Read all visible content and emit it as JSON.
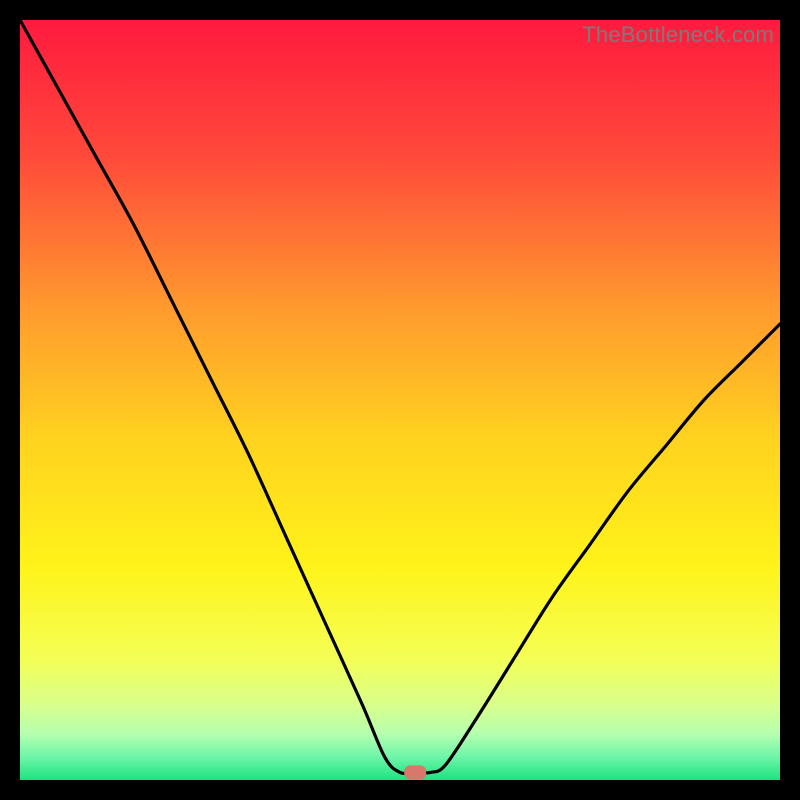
{
  "watermark": "TheBottleneck.com",
  "chart_data": {
    "type": "line",
    "title": "",
    "xlabel": "",
    "ylabel": "",
    "xlim": [
      0,
      100
    ],
    "ylim": [
      0,
      100
    ],
    "x": [
      0,
      5,
      10,
      15,
      20,
      25,
      30,
      35,
      40,
      45,
      48,
      50,
      52,
      54,
      56,
      60,
      65,
      70,
      75,
      80,
      85,
      90,
      95,
      100
    ],
    "values": [
      100,
      91,
      82,
      73,
      63,
      53,
      43,
      32,
      21,
      10,
      3,
      1,
      1,
      1,
      2,
      8,
      16,
      24,
      31,
      38,
      44,
      50,
      55,
      60
    ],
    "marker": {
      "x": 52,
      "y": 1
    },
    "gradient_stops": [
      {
        "offset": 0.0,
        "color": "#ff1a3f"
      },
      {
        "offset": 0.18,
        "color": "#ff4a3a"
      },
      {
        "offset": 0.38,
        "color": "#ff9a2e"
      },
      {
        "offset": 0.55,
        "color": "#ffd21f"
      },
      {
        "offset": 0.72,
        "color": "#fff31a"
      },
      {
        "offset": 0.84,
        "color": "#f4ff55"
      },
      {
        "offset": 0.9,
        "color": "#d9ff8a"
      },
      {
        "offset": 0.94,
        "color": "#b5ffb0"
      },
      {
        "offset": 0.97,
        "color": "#6cf5a8"
      },
      {
        "offset": 1.0,
        "color": "#1ee27f"
      }
    ]
  }
}
